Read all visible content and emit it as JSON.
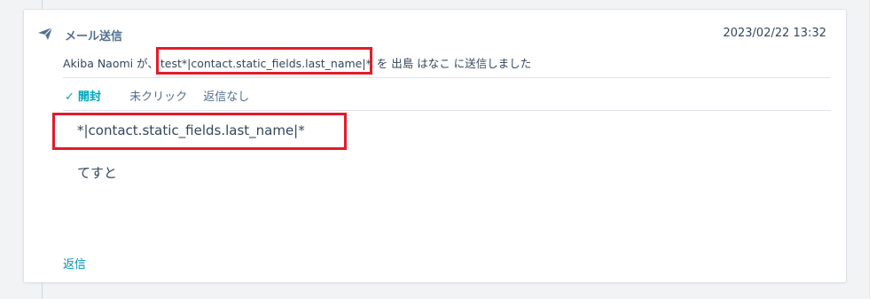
{
  "activity": {
    "title": "メール送信",
    "timestamp": "2023/02/22 13:32",
    "summary": {
      "sender": "Akiba Naomi",
      "particle_ga": " が、",
      "subject": "test*|contact.static_fields.last_name|*",
      "particle_wo": " を",
      "recipient": "出島 はなこ",
      "suffix": " に送信しました"
    },
    "status": {
      "opened": "開封",
      "clicked": "未クリック",
      "replied": "返信なし"
    },
    "body": {
      "line1": "*|contact.static_fields.last_name|*",
      "line2": "てすと"
    },
    "reply_label": "返信"
  },
  "colors": {
    "highlight": "#e21b2a",
    "link": "#0091ae",
    "opened": "#00a4bd"
  },
  "icons": {
    "send": "paper-plane-icon",
    "check": "check-icon"
  }
}
